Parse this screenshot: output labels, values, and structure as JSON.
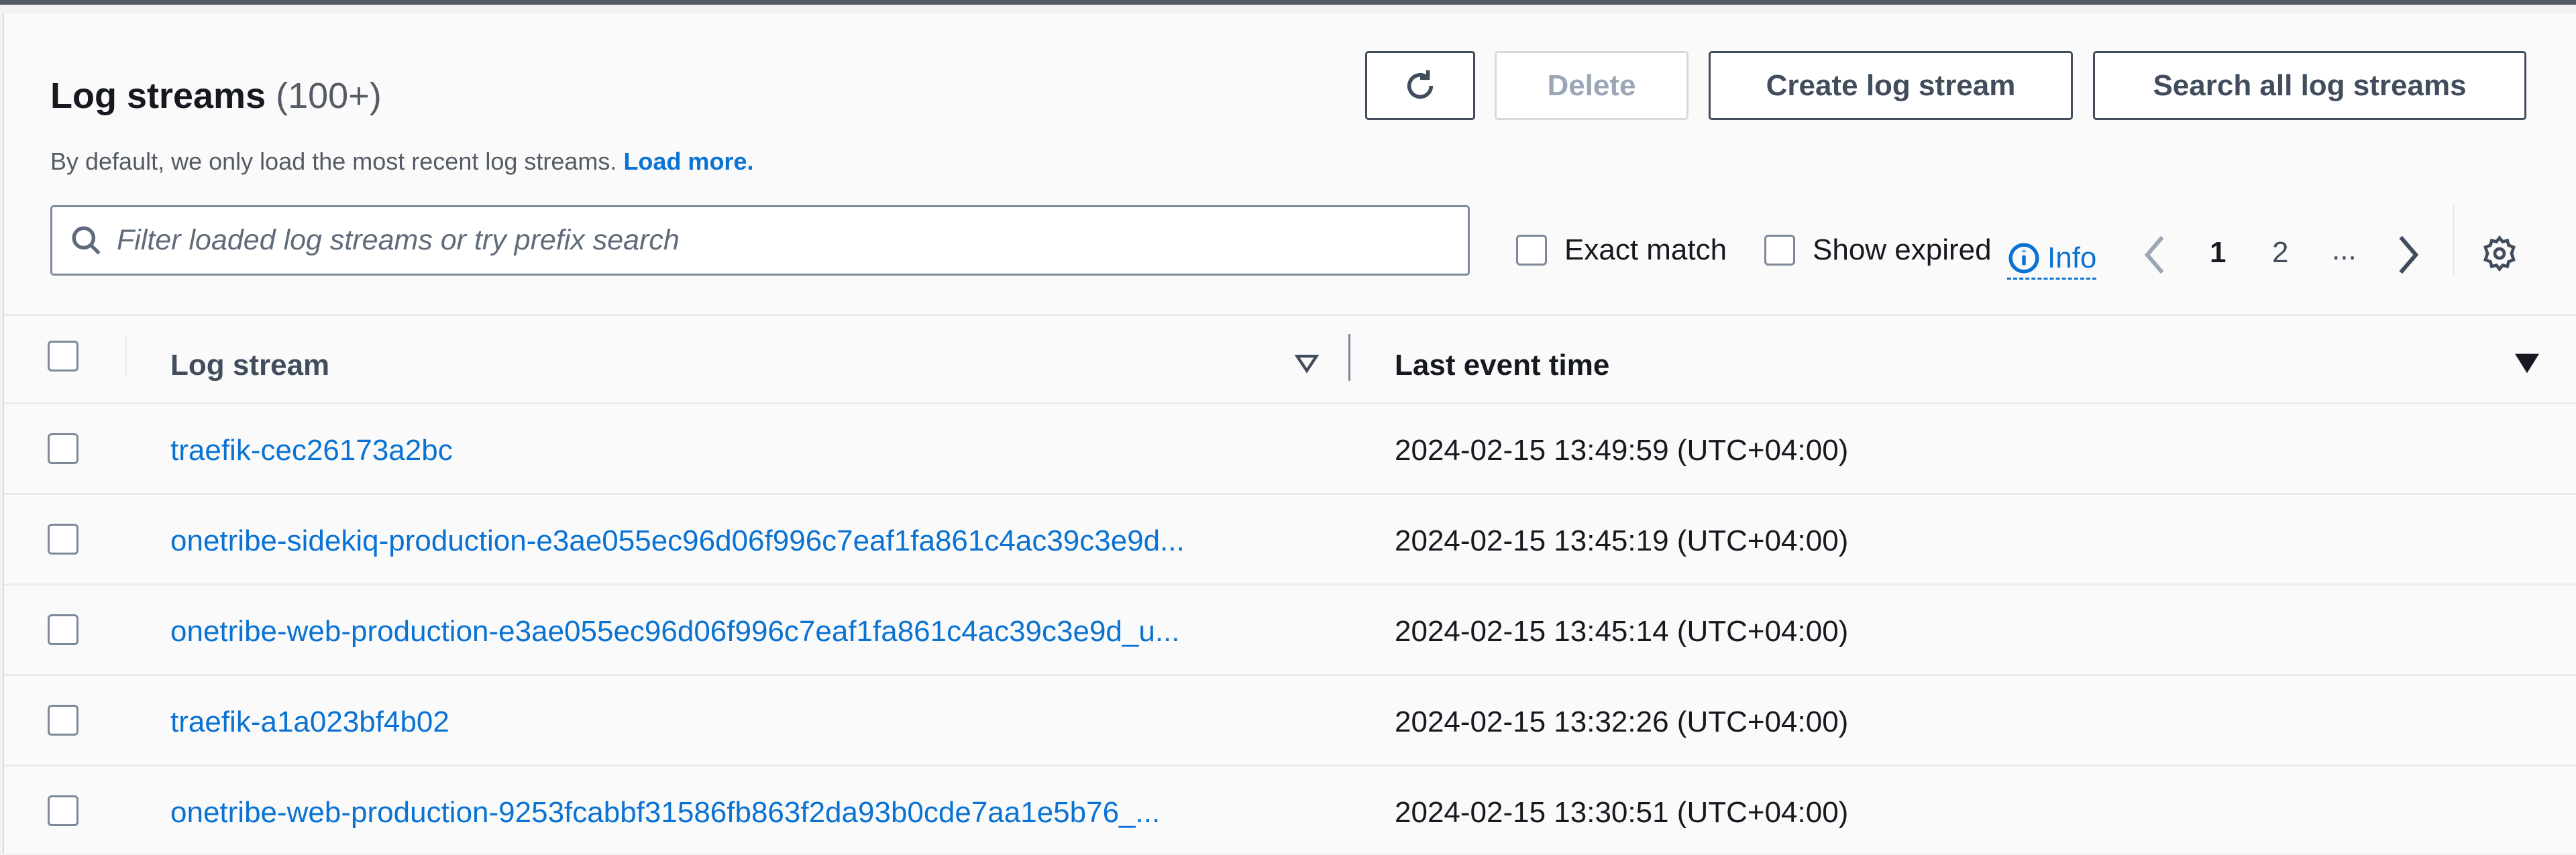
{
  "header": {
    "title": "Log streams",
    "count": "(100+)",
    "subtitle": "By default, we only load the most recent log streams.",
    "load_more": "Load more."
  },
  "toolbar": {
    "refresh_icon": "refresh-icon",
    "delete": "Delete",
    "create": "Create log stream",
    "search_all": "Search all log streams"
  },
  "filter": {
    "placeholder": "Filter loaded log streams or try prefix search",
    "value": "",
    "exact_match": "Exact match",
    "show_expired": "Show expired",
    "info": "Info"
  },
  "pagination": {
    "pages": [
      "1",
      "2",
      "..."
    ],
    "current": "1"
  },
  "table": {
    "columns": [
      "Log stream",
      "Last event time"
    ],
    "rows": [
      {
        "name": "traefik-cec26173a2bc",
        "time": "2024-02-15 13:49:59 (UTC+04:00)"
      },
      {
        "name": "onetribe-sidekiq-production-e3ae055ec96d06f996c7eaf1fa861c4ac39c3e9d...",
        "time": "2024-02-15 13:45:19 (UTC+04:00)"
      },
      {
        "name": "onetribe-web-production-e3ae055ec96d06f996c7eaf1fa861c4ac39c3e9d_u...",
        "time": "2024-02-15 13:45:14 (UTC+04:00)"
      },
      {
        "name": "traefik-a1a023bf4b02",
        "time": "2024-02-15 13:32:26 (UTC+04:00)"
      },
      {
        "name": "onetribe-web-production-9253fcabbf31586fb863f2da93b0cde7aa1e5b76_...",
        "time": "2024-02-15 13:30:51 (UTC+04:00)"
      }
    ]
  },
  "colors": {
    "link": "#0972d3",
    "border": "#414d5c"
  }
}
